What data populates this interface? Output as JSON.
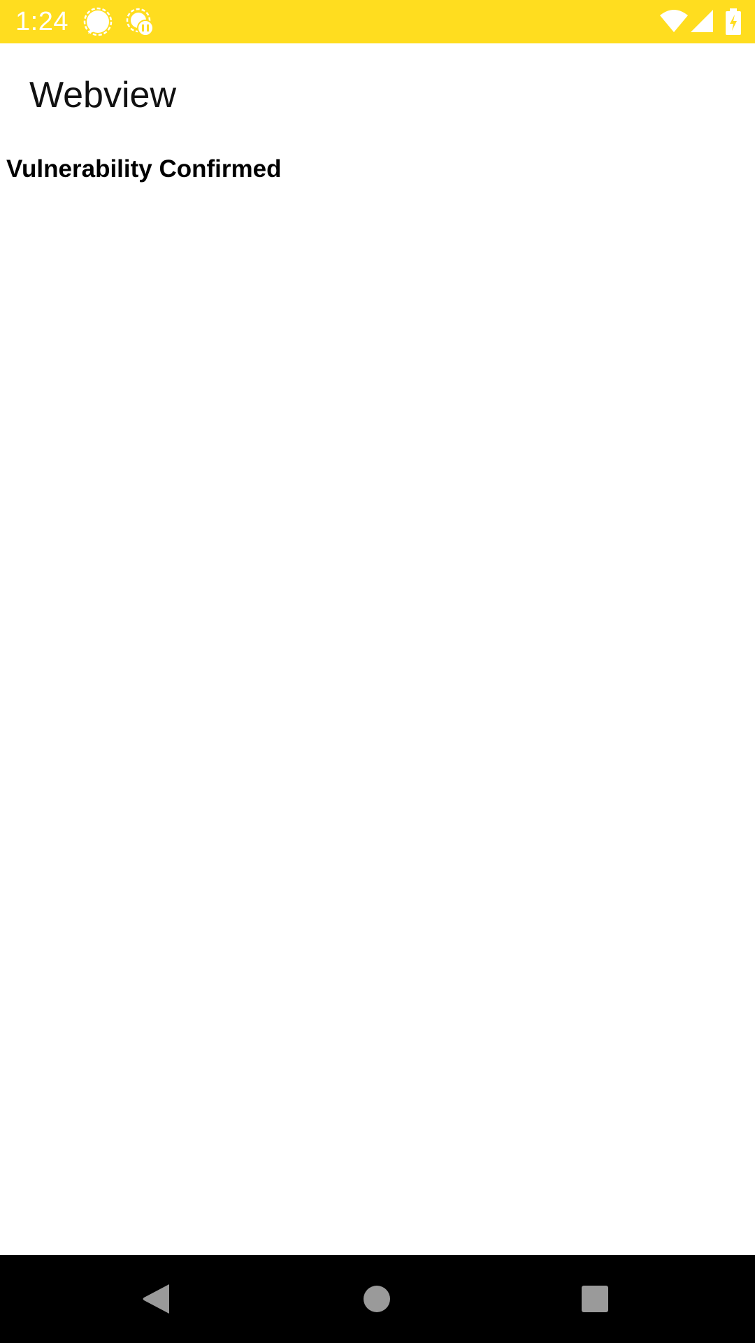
{
  "status_bar": {
    "time": "1:24",
    "background_color": "#FFDD1F",
    "icons": {
      "left": [
        "signal-messenger-icon",
        "signal-update-icon"
      ],
      "right": [
        "wifi-icon",
        "cellular-signal-icon",
        "battery-charging-icon"
      ]
    }
  },
  "app_bar": {
    "title": "Webview"
  },
  "webview": {
    "heading": "Vulnerability Confirmed"
  },
  "nav_bar": {
    "buttons": [
      "back-icon",
      "home-icon",
      "recents-icon"
    ]
  }
}
